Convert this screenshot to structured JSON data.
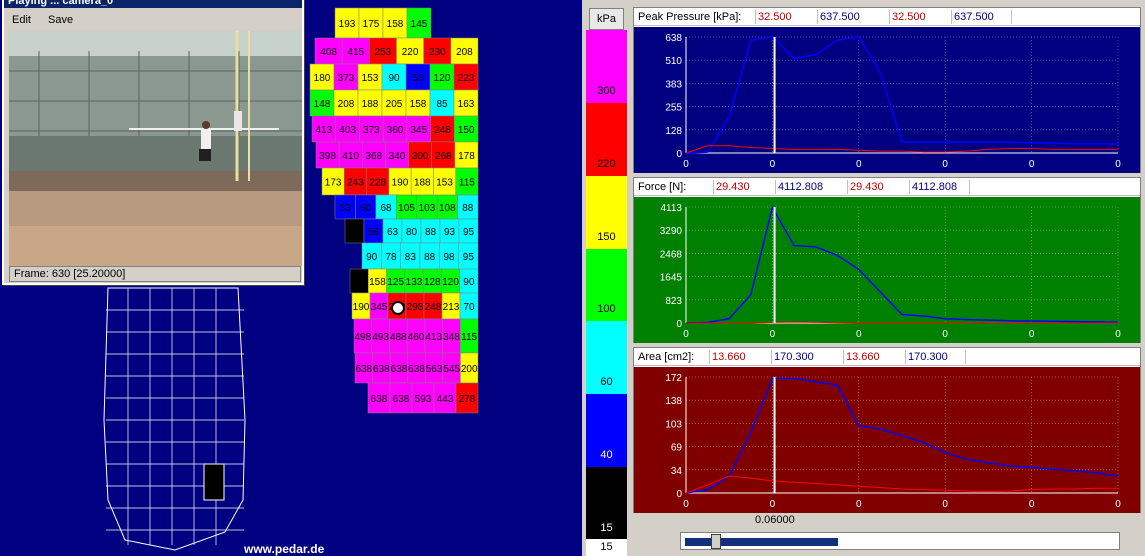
{
  "video_window": {
    "title": "Playing ... camera_0",
    "menu": [
      "Edit",
      "Save"
    ],
    "status": "Frame:  630 [25.20000]"
  },
  "foot": {
    "website": "www.pedar.de",
    "left_foot_value": "15",
    "rows": [
      [
        "193",
        "175",
        "158",
        "145"
      ],
      [
        "408",
        "415",
        "253",
        "220",
        "230",
        "208"
      ],
      [
        "180",
        "373",
        "153",
        "90",
        "53",
        "120",
        "223"
      ],
      [
        "148",
        "208",
        "188",
        "205",
        "158",
        "85",
        "163"
      ],
      [
        "413",
        "403",
        "373",
        "360",
        "345",
        "248",
        "150"
      ],
      [
        "398",
        "410",
        "368",
        "340",
        "300",
        "268",
        "178"
      ],
      [
        "173",
        "243",
        "228",
        "190",
        "188",
        "153",
        "115"
      ],
      [
        "53",
        "60",
        "68",
        "105",
        "103",
        "108",
        "88"
      ],
      [
        "30",
        "58",
        "63",
        "80",
        "88",
        "93",
        "95"
      ],
      [
        "90",
        "78",
        "83",
        "88",
        "98",
        "95"
      ],
      [
        "30",
        "158",
        "125",
        "133",
        "128",
        "120",
        "90"
      ],
      [
        "190",
        "345",
        "278",
        "298",
        "248",
        "213",
        "70"
      ],
      [
        "498",
        "493",
        "488",
        "460",
        "413",
        "348",
        "115"
      ],
      [
        "638",
        "638",
        "638",
        "638",
        "563",
        "545",
        "200"
      ],
      [
        "638",
        "638",
        "593",
        "443",
        "278"
      ]
    ]
  },
  "scale": {
    "unit": "kPa",
    "labels": [
      "300",
      "220",
      "150",
      "100",
      "60",
      "40",
      "15"
    ],
    "bottom": "15",
    "colors": [
      "#ff00ff",
      "#ff0000",
      "#ffff00",
      "#00ff00",
      "#00ffff",
      "#0000ff",
      "#000000"
    ]
  },
  "panels": [
    {
      "title": "Peak Pressure  [kPa]:",
      "v1": "32.500",
      "v2": "637.500",
      "v3": "32.500",
      "v4": "637.500",
      "bg": "#000080",
      "yticks": [
        "638",
        "510",
        "383",
        "255",
        "128",
        "0"
      ],
      "xticks": [
        "0",
        "0",
        "0",
        "0",
        "0",
        "0"
      ],
      "ymax": 638,
      "blue": [
        0,
        5,
        200,
        620,
        640,
        520,
        540,
        620,
        640,
        440,
        60,
        60,
        60,
        60,
        60,
        60,
        55,
        55,
        50,
        50,
        50
      ],
      "red": [
        0,
        40,
        40,
        30,
        25,
        20,
        20,
        20,
        15,
        10,
        10,
        5,
        5,
        10,
        20,
        25,
        25,
        20,
        20,
        20,
        20
      ]
    },
    {
      "title": "Force [N]:",
      "v1": "29.430",
      "v2": "4112.808",
      "v3": "29.430",
      "v4": "4112.808",
      "bg": "#008000",
      "yticks": [
        "4113",
        "3290",
        "2468",
        "1645",
        "823",
        "0"
      ],
      "xticks": [
        "0",
        "0",
        "0",
        "0",
        "0",
        "0"
      ],
      "ymax": 4113,
      "blue": [
        0,
        20,
        150,
        1000,
        4100,
        2750,
        2700,
        2400,
        1900,
        1100,
        300,
        250,
        150,
        120,
        100,
        80,
        70,
        60,
        50,
        40,
        30
      ],
      "red": [
        0,
        0,
        0,
        0,
        20,
        30,
        20,
        10,
        0,
        0,
        0,
        0,
        0,
        0,
        0,
        0,
        0,
        0,
        0,
        0,
        0
      ]
    },
    {
      "title": "Area [cm2]:",
      "v1": "13.660",
      "v2": "170.300",
      "v3": "13.660",
      "v4": "170.300",
      "bg": "#800000",
      "yticks": [
        "172",
        "138",
        "103",
        "69",
        "34",
        "0"
      ],
      "xticks": [
        "0",
        "0",
        "0",
        "0",
        "0",
        "0"
      ],
      "ymax": 172,
      "blue": [
        0,
        5,
        25,
        90,
        170,
        170,
        165,
        160,
        100,
        95,
        85,
        75,
        60,
        50,
        45,
        40,
        38,
        35,
        33,
        30,
        25
      ],
      "red": [
        0,
        12,
        25,
        22,
        18,
        16,
        14,
        12,
        10,
        8,
        6,
        5,
        4,
        3,
        2,
        3,
        5,
        6,
        6,
        7,
        7
      ]
    }
  ],
  "time_label": "0.06000",
  "slider_value": 0.35
}
